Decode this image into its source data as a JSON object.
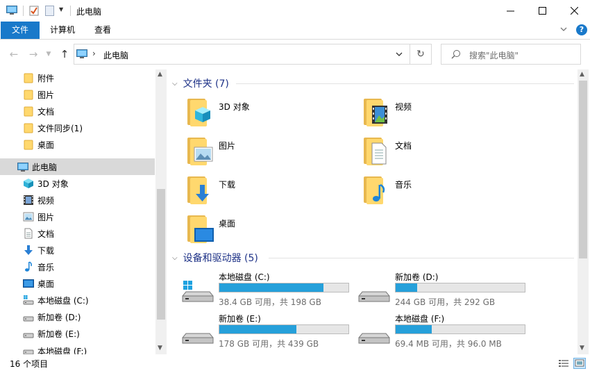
{
  "window": {
    "title": "此电脑"
  },
  "title_controls": {
    "minimize": "—",
    "maximize": "☐",
    "close": "✕"
  },
  "ribbon": {
    "tabs": [
      {
        "label": "文件"
      },
      {
        "label": "计算机"
      },
      {
        "label": "查看"
      }
    ],
    "accent": "#1979ca"
  },
  "address": {
    "path": "此电脑",
    "search_placeholder": "搜索\"此电脑\""
  },
  "nav": {
    "items": [
      {
        "label": "附件",
        "icon": "folder-icon"
      },
      {
        "label": "图片",
        "icon": "folder-icon"
      },
      {
        "label": "文档",
        "icon": "folder-icon"
      },
      {
        "label": "文件同步(1)",
        "icon": "folder-icon"
      },
      {
        "label": "桌面",
        "icon": "folder-icon"
      },
      {
        "label": "此电脑",
        "icon": "computer-icon"
      },
      {
        "label": "3D 对象",
        "icon": "3d-objects-icon"
      },
      {
        "label": "视频",
        "icon": "video-icon"
      },
      {
        "label": "图片",
        "icon": "pictures-icon"
      },
      {
        "label": "文档",
        "icon": "documents-icon"
      },
      {
        "label": "下载",
        "icon": "download-icon"
      },
      {
        "label": "音乐",
        "icon": "music-icon"
      },
      {
        "label": "桌面",
        "icon": "desktop-icon"
      },
      {
        "label": "本地磁盘 (C:)",
        "icon": "system-drive-icon"
      },
      {
        "label": "新加卷 (D:)",
        "icon": "drive-icon"
      },
      {
        "label": "新加卷 (E:)",
        "icon": "drive-icon"
      },
      {
        "label": "本地磁盘 (F:)",
        "icon": "drive-icon"
      }
    ]
  },
  "content": {
    "folders_header": "文件夹 (7)",
    "folders": [
      {
        "label": "3D 对象",
        "icon": "3d-objects-folder-icon"
      },
      {
        "label": "视频",
        "icon": "video-folder-icon"
      },
      {
        "label": "图片",
        "icon": "pictures-folder-icon"
      },
      {
        "label": "文档",
        "icon": "documents-folder-icon"
      },
      {
        "label": "下载",
        "icon": "download-folder-icon"
      },
      {
        "label": "音乐",
        "icon": "music-folder-icon"
      },
      {
        "label": "桌面",
        "icon": "desktop-folder-icon"
      }
    ],
    "drives_header": "设备和驱动器 (5)",
    "drives": [
      {
        "label": "本地磁盘 (C:)",
        "free": "38.4 GB 可用，共 198 GB",
        "used_fraction": 0.806
      },
      {
        "label": "新加卷 (D:)",
        "free": "244 GB 可用，共 292 GB",
        "used_fraction": 0.164
      },
      {
        "label": "新加卷 (E:)",
        "free": "178 GB 可用，共 439 GB",
        "used_fraction": 0.595
      },
      {
        "label": "本地磁盘 (F:)",
        "free": "69.4 MB 可用，共 96.0 MB",
        "used_fraction": 0.277
      }
    ]
  },
  "status": {
    "item_count": "16 个项目"
  }
}
